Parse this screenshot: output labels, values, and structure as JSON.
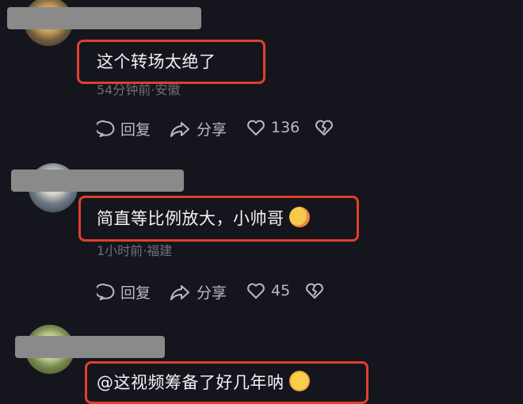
{
  "comments": [
    {
      "text": "这个转场太绝了",
      "meta": "54分钟前·安徽",
      "reply_label": "回复",
      "share_label": "分享",
      "like_count": "136",
      "emoji": ""
    },
    {
      "text": "简直等比例放大，小帅哥",
      "meta": "1小时前·福建",
      "reply_label": "回复",
      "share_label": "分享",
      "like_count": "45",
      "emoji": "hug-face-emoji"
    },
    {
      "text": "@这视频筹备了好几年呐",
      "meta": "",
      "reply_label": "",
      "share_label": "",
      "like_count": "",
      "emoji": "laughing-tears-emoji"
    }
  ],
  "colors": {
    "background": "#15161d",
    "highlight_border": "#e0402c",
    "meta_text": "#6d6e78",
    "action_text": "#b9bac2",
    "name_redaction": "#8a8a8a"
  }
}
